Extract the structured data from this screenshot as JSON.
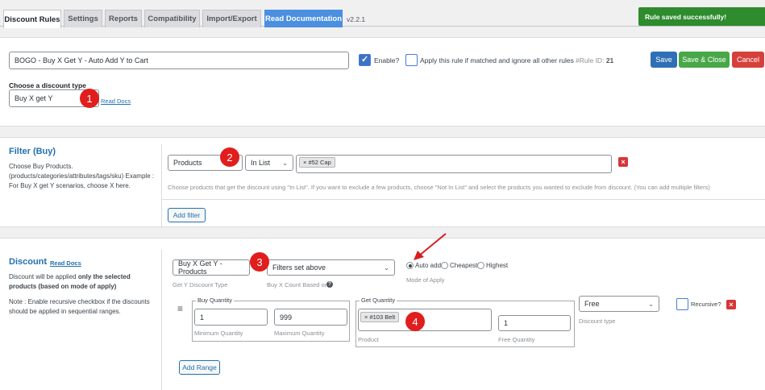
{
  "tabs": [
    {
      "label": "Discount Rules"
    },
    {
      "label": "Settings"
    },
    {
      "label": "Reports"
    },
    {
      "label": "Compatibility"
    },
    {
      "label": "Import/Export"
    },
    {
      "label": "Read Documentation"
    }
  ],
  "version": "v2.2.1",
  "toast": "Rule saved successfully!",
  "rule": {
    "name": "BOGO - Buy X Get Y - Auto Add Y to Cart",
    "enable_label": "Enable?",
    "exclusive_label": "Apply this rule if matched and ignore all other rules",
    "rule_id_prefix": "#Rule ID:",
    "rule_id": "21",
    "save": "Save",
    "save_close": "Save & Close",
    "cancel": "Cancel",
    "discount_type_label": "Choose a discount type",
    "discount_type_value": "Buy X get Y",
    "read_docs": "Read Docs"
  },
  "annotations": [
    "1",
    "2",
    "3",
    "4"
  ],
  "filter": {
    "title": "Filter (Buy)",
    "description": "Choose Buy Products. (products/categories/attributes/tags/sku) Example : For Buy X get Y scenarios, choose X here.",
    "type_value": "Products",
    "method_value": "In List",
    "selected_tag": "× #52 Cap",
    "hint": "Choose products that get the discount using \"In List\". If you want to exclude a few products, choose \"Not In List\" and select the products you wanted to exclude from discount. (You can add multiple filters)",
    "add_filter": "Add filter",
    "remove": "×"
  },
  "discount": {
    "title": "Discount",
    "read_docs": "Read Docs",
    "desc_prefix": "Discount will be applied ",
    "desc_bold": "only the selected products (based on mode of apply)",
    "note": "Note : Enable recursive checkbox if the discounts should be applied in sequential ranges.",
    "get_y_type_value": "Buy X Get Y - Products",
    "get_y_type_label": "Get Y Discount Type",
    "count_based_value": "Filters set above",
    "count_based_label": "Buy X Count Based on",
    "mode_options": [
      "Auto add",
      "Cheapest",
      "Highest"
    ],
    "mode_label": "Mode of Apply",
    "buy_qty_legend": "Buy Quantity",
    "min_qty": "1",
    "max_qty": "999",
    "min_label": "Minimum Quantity",
    "max_label": "Maximum Quantity",
    "get_qty_legend": "Get Quantity",
    "product_tag": "× #103 Belt",
    "product_label": "Product",
    "free_qty": "1",
    "free_qty_label": "Free Quantity",
    "discount_type_value": "Free",
    "discount_type_label": "Discount type",
    "recursive_label": "Recursive?",
    "add_range": "Add Range",
    "remove": "×"
  },
  "colors": {
    "accent": "#2271b1",
    "success": "#2e8b2e",
    "danger": "#d63638",
    "badge": "#e11d1d"
  }
}
